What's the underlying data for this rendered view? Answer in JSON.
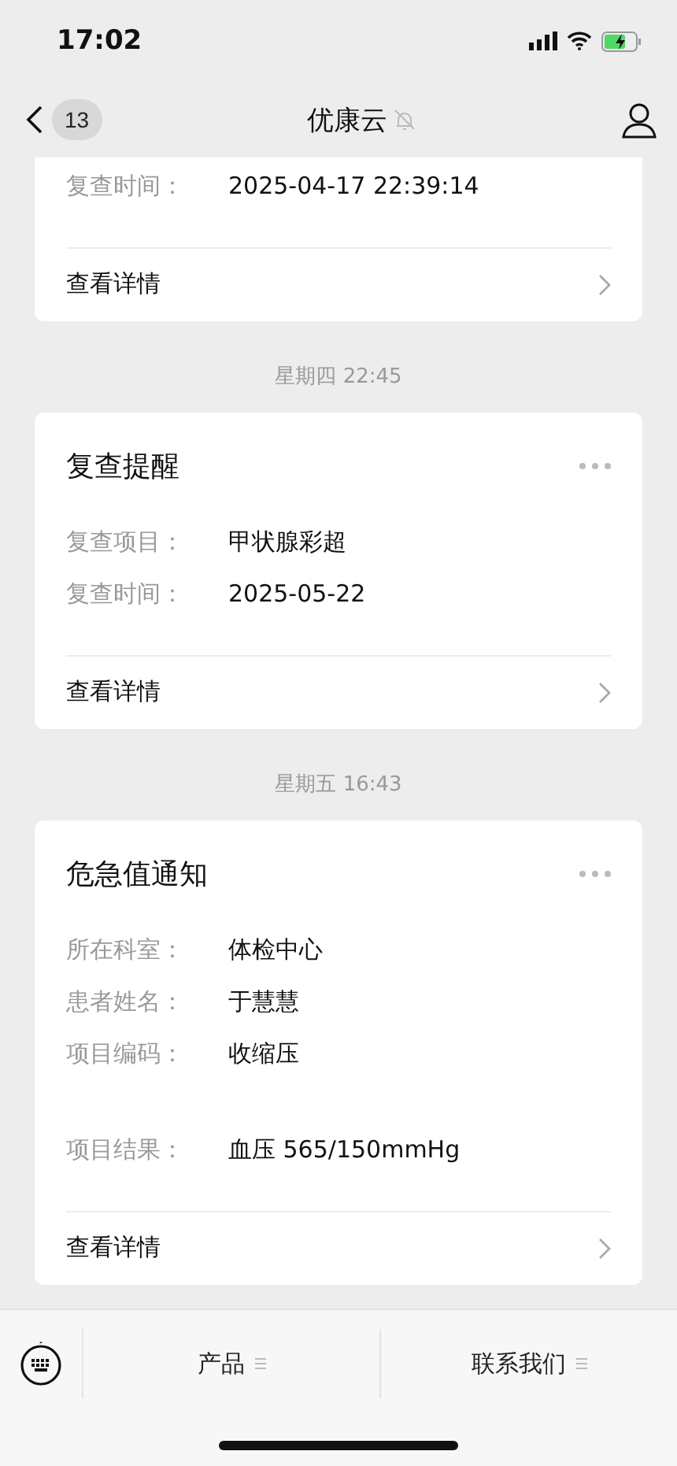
{
  "status_bar": {
    "time": "17:02"
  },
  "nav": {
    "back_count": "13",
    "title": "优康云",
    "muted": true
  },
  "messages": [
    {
      "truncated": true,
      "fields": [
        {
          "label": "复查时间：",
          "value": "2025-04-17 22:39:14",
          "kind": "plain"
        }
      ],
      "link": "查看详情"
    },
    {
      "timestamp": "星期四 22:45",
      "truncated": false,
      "title": "复查提醒",
      "fields": [
        {
          "label": "复查项目：",
          "value": "甲状腺彩超",
          "kind": "plain"
        },
        {
          "label": "复查时间：",
          "value": "2025-05-22",
          "kind": "plain"
        }
      ],
      "link": "查看详情"
    },
    {
      "timestamp": "星期五 16:43",
      "truncated": false,
      "title": "危急值通知",
      "fields": [
        {
          "label": "所在科室：",
          "value": "体检中心",
          "kind": "plain"
        },
        {
          "label": "患者姓名：",
          "value": "于慧慧",
          "kind": "plain"
        },
        {
          "label": "项目编码：",
          "value": "收缩压",
          "kind": "plain"
        },
        {
          "label": "项目结果：",
          "value": "血压 565/150mmHg",
          "kind": "spaced"
        }
      ],
      "link": "查看详情"
    }
  ],
  "menu": [
    {
      "label": "产品"
    },
    {
      "label": "联系我们"
    }
  ]
}
